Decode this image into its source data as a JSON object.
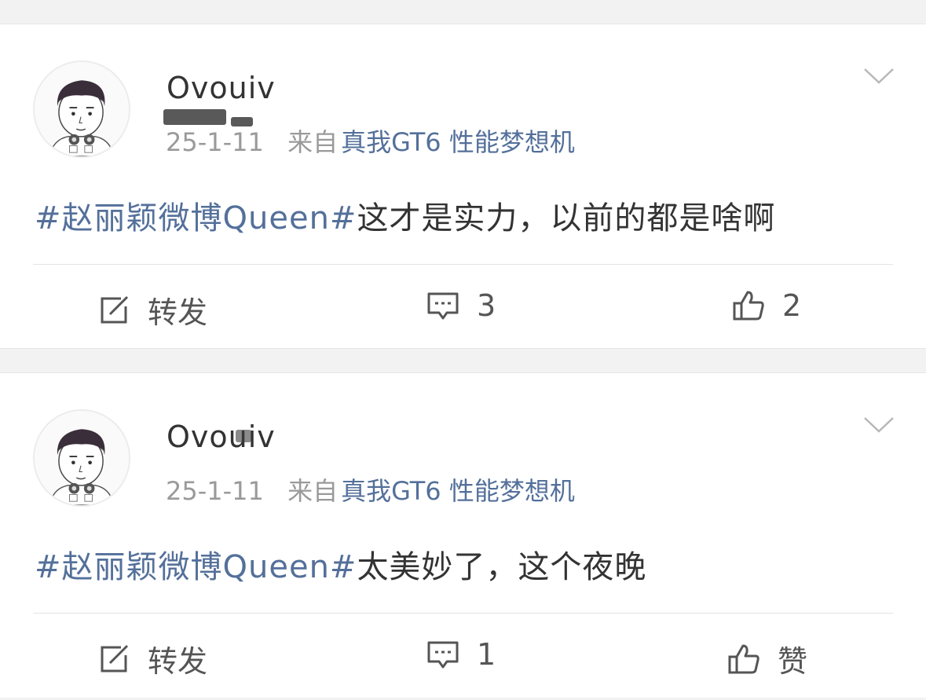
{
  "posts": [
    {
      "username": "Ovouiv",
      "date": "25-1-11",
      "from_label": "来自",
      "device": "真我GT6 性能梦想机",
      "hashtag": "#赵丽颖微博Queen#",
      "text": "这才是实力，以前的都是啥啊",
      "repost_label": "转发",
      "comment_count": "3",
      "like_label": "2"
    },
    {
      "username": "Ovouiv",
      "date": "25-1-11",
      "from_label": "来自",
      "device": "真我GT6 性能梦想机",
      "hashtag": "#赵丽颖微博Queen#",
      "text": "太美妙了，这个夜晚",
      "repost_label": "转发",
      "comment_count": "1",
      "like_label": "赞"
    }
  ],
  "icons": {
    "repost": "share-edit-icon",
    "comment": "comment-icon",
    "like": "thumbs-up-icon",
    "menu": "chevron-down-icon"
  },
  "colors": {
    "link": "#54709a",
    "meta": "#9a9a9a",
    "text": "#333333",
    "background": "#f2f2f2"
  }
}
